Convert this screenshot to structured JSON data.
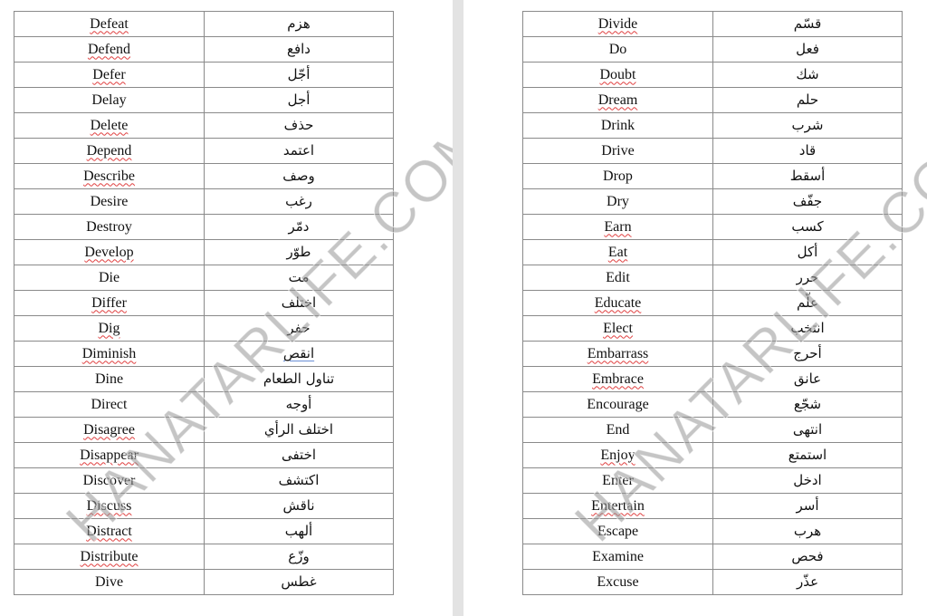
{
  "document": {
    "watermark": "HANATARLIFE.COM",
    "colors": {
      "border": "#8a8a8a",
      "gutter": "#e3e3e3",
      "spellcheck_underline": "#e04040",
      "grammar_underline": "#6a8fd6",
      "watermark": "#969696"
    }
  },
  "pages": [
    {
      "rows": [
        {
          "en": "Defeat",
          "ar": "هزم",
          "en_flag": "spell"
        },
        {
          "en": "Defend",
          "ar": "دافع",
          "en_flag": "spell"
        },
        {
          "en": "Defer",
          "ar": "أجّل",
          "en_flag": "spell"
        },
        {
          "en": "Delay",
          "ar": "أجل",
          "en_flag": ""
        },
        {
          "en": "Delete",
          "ar": "حذف",
          "en_flag": "spell"
        },
        {
          "en": "Depend",
          "ar": "اعتمد",
          "en_flag": "spell"
        },
        {
          "en": "Describe",
          "ar": "وصف",
          "en_flag": "spell"
        },
        {
          "en": "Desire",
          "ar": "رغب",
          "en_flag": ""
        },
        {
          "en": "Destroy",
          "ar": "دمّر",
          "en_flag": ""
        },
        {
          "en": "Develop",
          "ar": "طوّر",
          "en_flag": "spell"
        },
        {
          "en": "Die",
          "ar": "مت",
          "en_flag": ""
        },
        {
          "en": "Differ",
          "ar": "اختلف",
          "en_flag": "spell"
        },
        {
          "en": "Dig",
          "ar": "حفر",
          "en_flag": "spell"
        },
        {
          "en": "Diminish",
          "ar": "انقص",
          "en_flag": "spell",
          "ar_flag": "grammar"
        },
        {
          "en": "Dine",
          "ar": "تناول الطعام",
          "en_flag": ""
        },
        {
          "en": "Direct",
          "ar": "أوجه",
          "en_flag": ""
        },
        {
          "en": "Disagree",
          "ar": "اختلف الرأي",
          "en_flag": "spell"
        },
        {
          "en": "Disappear",
          "ar": "اختفى",
          "en_flag": "spell"
        },
        {
          "en": "Discover",
          "ar": "اكتشف",
          "en_flag": ""
        },
        {
          "en": "Discuss",
          "ar": "ناقش",
          "en_flag": "spell"
        },
        {
          "en": "Distract",
          "ar": "ألهب",
          "en_flag": "spell"
        },
        {
          "en": "Distribute",
          "ar": "وزّع",
          "en_flag": "spell"
        },
        {
          "en": "Dive",
          "ar": "غطس",
          "en_flag": ""
        }
      ]
    },
    {
      "rows": [
        {
          "en": "Divide",
          "ar": "قسّم",
          "en_flag": "spell"
        },
        {
          "en": "Do",
          "ar": "فعل",
          "en_flag": ""
        },
        {
          "en": "Doubt",
          "ar": "شك",
          "en_flag": "spell"
        },
        {
          "en": "Dream",
          "ar": "حلم",
          "en_flag": "spell"
        },
        {
          "en": "Drink",
          "ar": "شرب",
          "en_flag": ""
        },
        {
          "en": "Drive",
          "ar": "قاد",
          "en_flag": ""
        },
        {
          "en": "Drop",
          "ar": "أسقط",
          "en_flag": ""
        },
        {
          "en": "Dry",
          "ar": "جفّف",
          "en_flag": ""
        },
        {
          "en": "Earn",
          "ar": "كسب",
          "en_flag": "spell"
        },
        {
          "en": "Eat",
          "ar": "أكل",
          "en_flag": "spell"
        },
        {
          "en": "Edit",
          "ar": "حرر",
          "en_flag": ""
        },
        {
          "en": "Educate",
          "ar": "علّم",
          "en_flag": "spell"
        },
        {
          "en": "Elect",
          "ar": "انتخب",
          "en_flag": "spell"
        },
        {
          "en": "Embarrass",
          "ar": "أحرج",
          "en_flag": "spell"
        },
        {
          "en": "Embrace",
          "ar": "عانق",
          "en_flag": "spell"
        },
        {
          "en": "Encourage",
          "ar": "شجّع",
          "en_flag": ""
        },
        {
          "en": "End",
          "ar": "انتهى",
          "en_flag": ""
        },
        {
          "en": "Enjoy",
          "ar": "استمتع",
          "en_flag": "spell"
        },
        {
          "en": "Enter",
          "ar": "ادخل",
          "en_flag": ""
        },
        {
          "en": "Entertain",
          "ar": "أسر",
          "en_flag": "spell"
        },
        {
          "en": "Escape",
          "ar": "هرب",
          "en_flag": ""
        },
        {
          "en": "Examine",
          "ar": "فحص",
          "en_flag": ""
        },
        {
          "en": "Excuse",
          "ar": "عذّر",
          "en_flag": ""
        }
      ]
    }
  ]
}
